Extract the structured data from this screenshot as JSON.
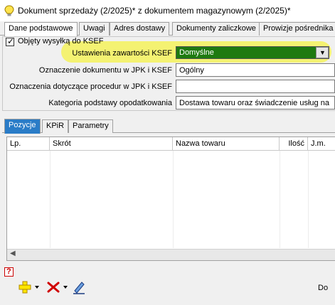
{
  "window": {
    "title": "Dokument sprzedaży (2/2025)* z dokumentem magazynowym (2/2025)*"
  },
  "top_tabs": [
    {
      "label": "Dane podstawowe",
      "active": true
    },
    {
      "label": "Uwagi",
      "active": false
    },
    {
      "label": "Adres dostawy",
      "active": false
    },
    {
      "label": "Dokumenty zaliczkowe",
      "active": false
    },
    {
      "label": "Prowizje pośrednika",
      "active": false
    }
  ],
  "ksef": {
    "checkbox_label": "Objęty wysyłką do KSEF",
    "checked": true,
    "settings_label": "Ustawienia zawartości KSEF",
    "settings_value": "Domyślne",
    "jpk_label": "Oznaczenie dokumentu w JPK i KSEF",
    "jpk_value": "Ogólny",
    "procedures_label": "Oznaczenia dotyczące procedur w JPK i KSEF",
    "procedures_value": "",
    "category_label": "Kategoria podstawy opodatkowania",
    "category_value": "Dostawa towaru oraz świadczenie usług na",
    "highlight_color": "#f4f25c",
    "select_color": "#1e7a10"
  },
  "sub_tabs": [
    {
      "label": "Pozycje",
      "active": true
    },
    {
      "label": "KPiR",
      "active": false
    },
    {
      "label": "Parametry",
      "active": false
    }
  ],
  "grid": {
    "columns": [
      "Lp.",
      "Skrót",
      "Nazwa towaru",
      "Ilość",
      "J.m."
    ]
  },
  "footer": {
    "text": "Do"
  },
  "icons": [
    "lightbulb-icon",
    "help-icon",
    "add-icon",
    "delete-icon",
    "edit-icon",
    "dropdown-arrow-icon"
  ]
}
